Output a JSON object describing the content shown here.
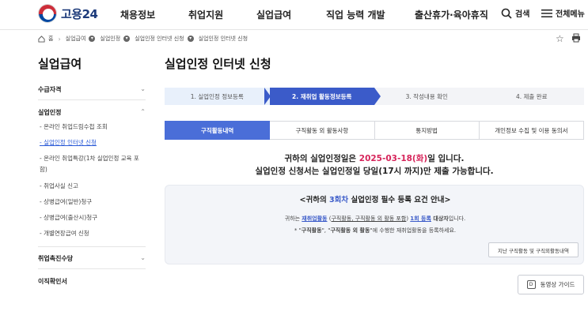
{
  "header": {
    "logo_text": "고용24",
    "nav": [
      "채용정보",
      "취업지원",
      "실업급여",
      "직업 능력 개발",
      "출산휴가·육아휴직"
    ],
    "search_label": "검색",
    "menu_label": "전체메뉴"
  },
  "breadcrumb": [
    "홈",
    "실업급여",
    "실업인정",
    "실업인정 인터넷 신청",
    "실업인정 인터넷 신청"
  ],
  "sidebar": {
    "title": "실업급여",
    "sections": [
      {
        "label": "수급자격"
      },
      {
        "label": "실업인정"
      },
      {
        "label": "취업촉진수당"
      },
      {
        "label": "이직확인서"
      }
    ],
    "subitems": [
      "- 온라인 취업드림수첩 조회",
      "- 실업인정 인터넷 신청",
      "- 온라인 취업특강(1차 실업인정 교육 포함)",
      "- 취업사실 신고",
      "- 상병급여(일반)청구",
      "- 상병급여(출산시)청구",
      "- 개별연장급여 신청"
    ]
  },
  "main": {
    "title": "실업인정 인터넷 신청",
    "steps": [
      "1. 실업인정 정보등록",
      "2. 재취업 활동정보등록",
      "3. 작성내용 확인",
      "4. 제출 완료"
    ],
    "active_step": 2,
    "tabs": [
      "구직활동내역",
      "구직활동 외 활동사항",
      "통지방법",
      "개인정보 수집 및 이용 동의서"
    ],
    "notice": {
      "line1_prefix": "귀하의 실업인정일은 ",
      "date": "2025-03-18(화)",
      "line1_suffix": "일 입니다.",
      "line2": "실업인정 신청서는 실업인정일 당일(17시 까지)만 제출 가능합니다."
    },
    "infobox": {
      "title_prefix": "<귀하의 ",
      "title_highlight": "3회차",
      "title_suffix": " 실업인정 필수 등록 요건 안내>",
      "l1_a": "귀하는 ",
      "l1_b": "재취업활동",
      "l1_c": " (",
      "l1_d": "구직활동, 구직활동 외 활동 포함",
      "l1_e": ") ",
      "l1_f": "1회 등록",
      "l1_g": " 대상자",
      "l1_h": "입니다.",
      "l2_a": "* \"",
      "l2_b": "구직활동",
      "l2_c": "\", \"",
      "l2_d": "구직활동 외 활동",
      "l2_e": "\"에 수행한 재취업활동을 등록하세요.",
      "history_button": "지난 구직활동 및 구직외활동내역"
    },
    "video_guide": "동영상 가이드"
  },
  "colors": {
    "primary": "#3b5bc9",
    "date": "#d6245a",
    "link": "#2b5bd7"
  }
}
